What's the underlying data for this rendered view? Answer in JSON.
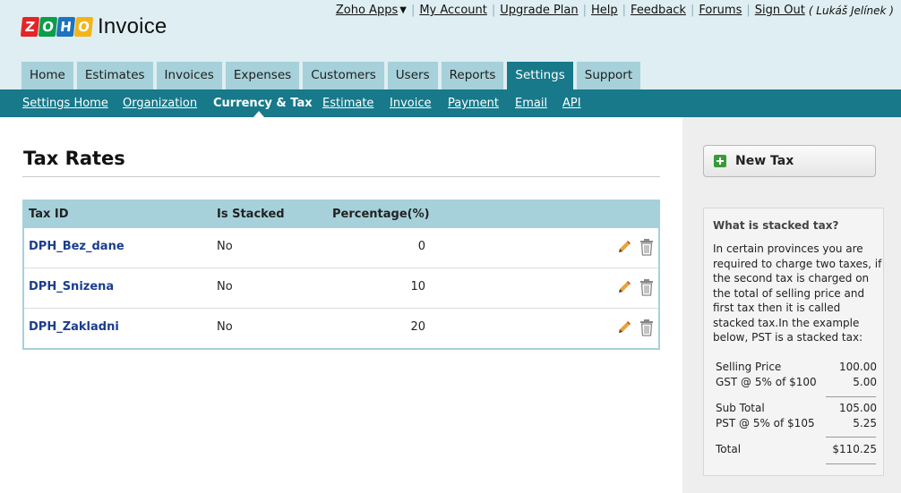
{
  "logo": {
    "letters": [
      "Z",
      "O",
      "H",
      "O"
    ],
    "letter_colors": [
      "#e42527",
      "#0a9e4a",
      "#1e73be",
      "#f2b418"
    ],
    "word": "Invoice"
  },
  "top_links": {
    "apps": "Zoho Apps",
    "my_account": "My Account",
    "upgrade": "Upgrade Plan",
    "help": "Help",
    "feedback": "Feedback",
    "forums": "Forums",
    "sign_out": "Sign Out",
    "user": "( Lukáš Jelínek )"
  },
  "tabs": [
    "Home",
    "Estimates",
    "Invoices",
    "Expenses",
    "Customers",
    "Users",
    "Reports",
    "Settings",
    "Support"
  ],
  "active_tab": "Settings",
  "subnav": [
    "Settings Home",
    "Organization",
    "Currency & Tax",
    "Estimate",
    "Invoice",
    "Payment",
    "Email",
    "API"
  ],
  "active_subnav": "Currency & Tax",
  "page_title": "Tax Rates",
  "table": {
    "headers": [
      "Tax ID",
      "Is Stacked",
      "Percentage(%)"
    ],
    "rows": [
      {
        "id": "DPH_Bez_dane",
        "stacked": "No",
        "pct": "0"
      },
      {
        "id": "DPH_Snizena",
        "stacked": "No",
        "pct": "10"
      },
      {
        "id": "DPH_Zakladni",
        "stacked": "No",
        "pct": "20"
      }
    ]
  },
  "sidebar": {
    "new_tax_label": "New Tax",
    "info_title": "What is stacked tax?",
    "info_text": "In certain provinces you are required to charge two taxes, if the second tax is charged on the total of selling price and first tax then it is called stacked tax.In the example below, PST is a stacked tax:",
    "example": [
      {
        "label": "Selling Price",
        "value": "100.00"
      },
      {
        "label": "GST @ 5% of $100",
        "value": "5.00"
      },
      {
        "label": "Sub Total",
        "value": "105.00"
      },
      {
        "label": "PST @ 5% of $105",
        "value": "5.25"
      },
      {
        "label": "Total",
        "value": "$110.25"
      }
    ]
  },
  "colors": {
    "header_bg": "#dfeef2",
    "tab_bg": "#a6d1da",
    "accent": "#17798a",
    "link_blue": "#1a3d8f"
  }
}
